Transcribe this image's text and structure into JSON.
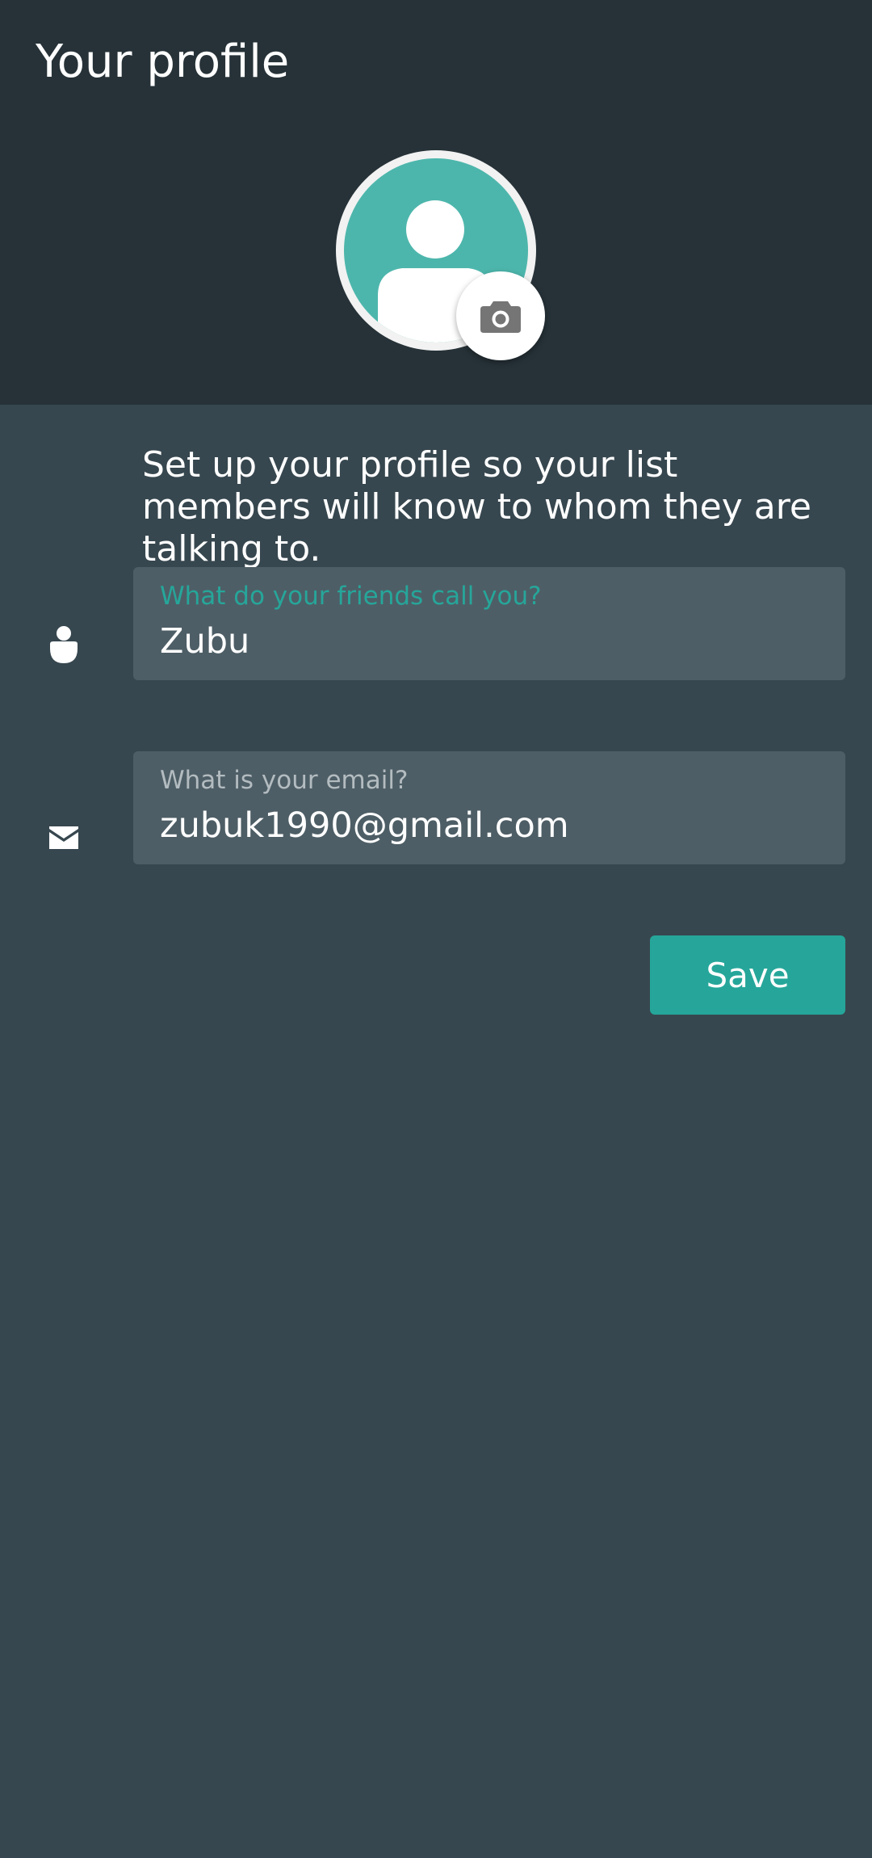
{
  "header": {
    "title": "Your profile"
  },
  "avatar": {
    "icon": "default-user-avatar",
    "background_color": "#4db6ac",
    "camera_icon": "camera-icon"
  },
  "intro_text": "Set up your profile so your list members will know to whom they are talking to.",
  "form": {
    "name_field": {
      "label": "What do your friends call you?",
      "value": "Zubu",
      "icon": "person-icon",
      "focused": true
    },
    "email_field": {
      "label": "What is your email?",
      "value": "zubuk1990@gmail.com",
      "icon": "envelope-icon",
      "focused": false
    },
    "save_label": "Save"
  },
  "colors": {
    "header_bg": "#263238",
    "body_bg": "#37474f",
    "field_bg": "#4e5e66",
    "accent": "#26a69a"
  }
}
